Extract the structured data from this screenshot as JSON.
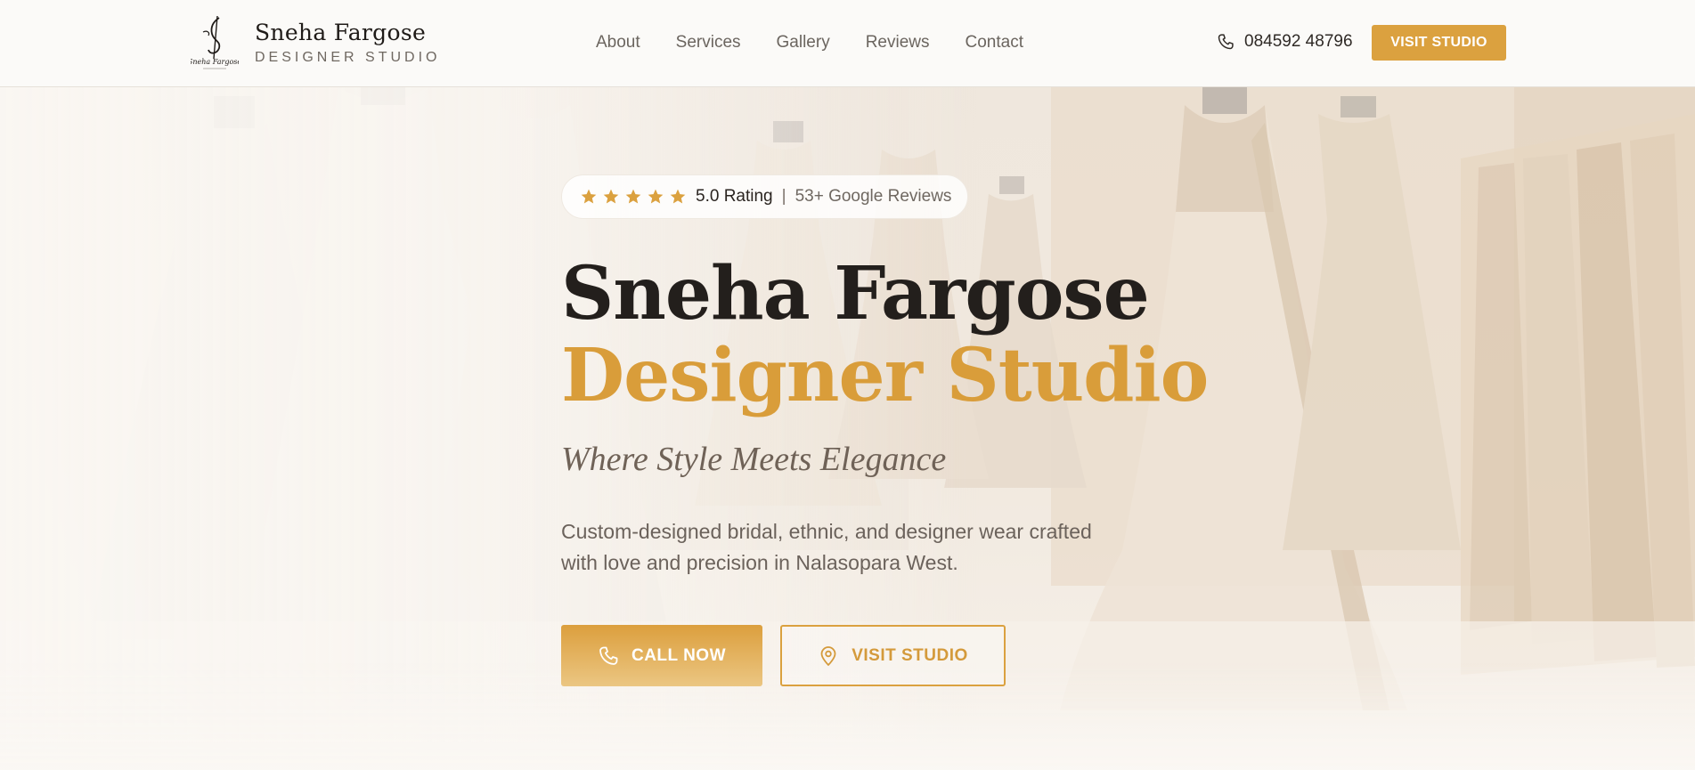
{
  "header": {
    "brand_name": "Sneha Fargose",
    "brand_sub": "DESIGNER STUDIO",
    "nav": [
      "About",
      "Services",
      "Gallery",
      "Reviews",
      "Contact"
    ],
    "phone": "084592 48796",
    "cta_label": "VISIT STUDIO"
  },
  "hero": {
    "rating_value": "5.0 Rating",
    "rating_separator": "|",
    "rating_reviews": "53+ Google Reviews",
    "star_count": 5,
    "title_line1": "Sneha Fargose",
    "title_line2": "Designer Studio",
    "tagline": "Where Style Meets Elegance",
    "description": "Custom-designed bridal, ethnic, and designer wear crafted with love and precision in Nalasopara West.",
    "call_label": "CALL NOW",
    "visit_label": "VISIT STUDIO"
  },
  "icons": {
    "brand_logo": "signature-logo-icon",
    "phone": "phone-icon",
    "star": "star-icon",
    "location": "map-pin-icon"
  },
  "colors": {
    "accent": "#dba13f",
    "title_dark": "#231f1c",
    "title_accent": "#d99d3a",
    "text_muted": "#6b625b",
    "background": "#f7f3ee"
  }
}
